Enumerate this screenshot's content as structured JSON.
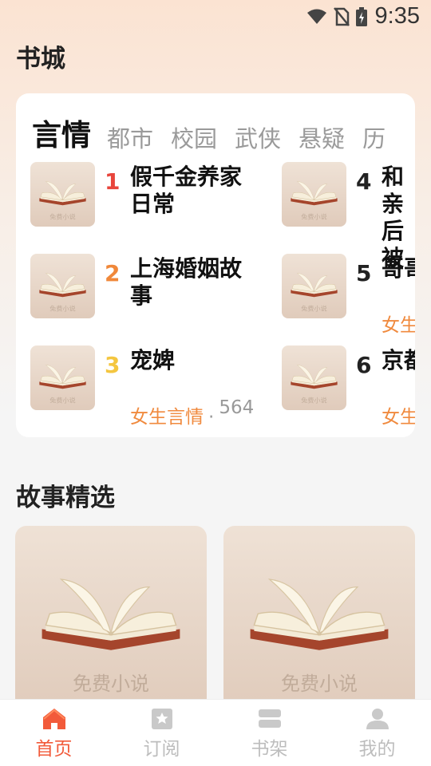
{
  "status_bar": {
    "time": "9:35"
  },
  "page_title": "书城",
  "ranking": {
    "tabs": [
      "言情",
      "都市",
      "校园",
      "武侠",
      "悬疑",
      "历"
    ],
    "books": [
      {
        "rank": "1",
        "title": "假千金养家日常",
        "category": "",
        "count": ""
      },
      {
        "rank": "2",
        "title": "上海婚姻故事",
        "category": "",
        "count": ""
      },
      {
        "rank": "3",
        "title": "宠婢",
        "category": "女生言情",
        "count": "564"
      },
      {
        "rank": "4",
        "title": "和亲后被",
        "category": "",
        "count": ""
      },
      {
        "rank": "5",
        "title": "哥哥",
        "category": "女生",
        "count": ""
      },
      {
        "rank": "6",
        "title": "京都",
        "category": "女生",
        "count": ""
      }
    ],
    "cover_watermark": "免费小说"
  },
  "stories": {
    "section_title": "故事精选",
    "cover_watermark": "免费小说"
  },
  "bottom_nav": [
    {
      "label": "首页",
      "icon": "home-icon",
      "active": true
    },
    {
      "label": "订阅",
      "icon": "bookmark-icon",
      "active": false
    },
    {
      "label": "书架",
      "icon": "bookshelf-icon",
      "active": false
    },
    {
      "label": "我的",
      "icon": "user-icon",
      "active": false
    }
  ],
  "colors": {
    "accent": "#f25a3a",
    "rank1": "#e8453c",
    "rank2": "#f0883a",
    "rank3": "#f4c640",
    "category": "#f08a3e"
  }
}
